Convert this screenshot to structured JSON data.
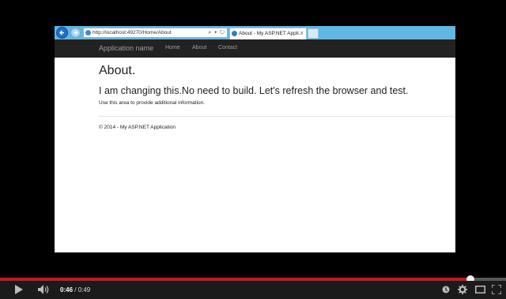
{
  "browser": {
    "url": "http://localhost:49270/Home/About",
    "address_tools": "⌕ ▾ ↻",
    "tab_title": "About - My ASP.NET Appli...",
    "tab_close": "×"
  },
  "navbar": {
    "brand": "Application name",
    "links": [
      "Home",
      "About",
      "Contact"
    ]
  },
  "page": {
    "title": "About.",
    "lead": "I am changing this.No need to build. Let's refresh the browser and test.",
    "small": "Use this area to provide additional information.",
    "footer": "© 2014 - My ASP.NET Application"
  },
  "player": {
    "current_time": "0:46",
    "separator": " / ",
    "duration": "0:49",
    "progress_fraction": 0.93,
    "colors": {
      "progress": "#cc181e",
      "controls_bg": "#1b1b1b"
    },
    "icons": [
      "play-icon",
      "volume-icon",
      "info-icon",
      "settings-gear-icon",
      "theater-mode-icon",
      "fullscreen-icon"
    ]
  }
}
